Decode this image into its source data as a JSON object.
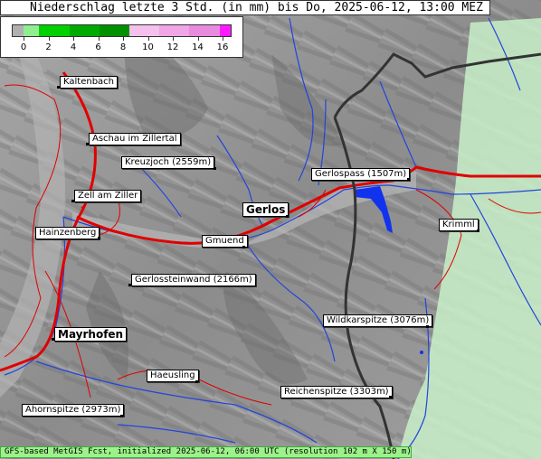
{
  "title": "Niederschlag letzte 3 Std. (in mm) bis Do, 2025-06-12, 13:00 MEZ",
  "legend": {
    "ticks": [
      "0",
      "2",
      "4",
      "6",
      "8",
      "10",
      "12",
      "14",
      "16"
    ],
    "colors": [
      "#b0b0b0",
      "#90ee90",
      "#00d000",
      "#00aa00",
      "#009000",
      "#f4c0ec",
      "#f0a6e6",
      "#e88ade",
      "#ff1aff"
    ]
  },
  "places": {
    "kaltenbach": "Kaltenbach",
    "aschau": "Aschau im Zillertal",
    "kreuzjoch": "Kreuzjoch (2559m)",
    "gerlospass": "Gerlospass (1507m)",
    "zell": "Zell am Ziller",
    "gerlos": "Gerlos",
    "krimml": "Krimml",
    "hainzenberg": "Hainzenberg",
    "gmuend": "Gmuend",
    "gerlossteinwand": "Gerlossteinwand (2166m)",
    "wildkarspitze": "Wildkarspitze (3076m)",
    "mayrhofen": "Mayrhofen",
    "haeusling": "Haeusling",
    "reichenspitze": "Reichenspitze (3303m)",
    "ahornspitze": "Ahornspitze (2973m)"
  },
  "footer": "GFS-based MetGIS Fcst, initialized 2025-06-12, 06:00 UTC  (resolution 102 m X 150 m)",
  "colors": {
    "road": "#e00000",
    "river": "#2244dd",
    "border": "#333333",
    "lake": "#1133ee",
    "rain_light": "#c8f0c8"
  }
}
